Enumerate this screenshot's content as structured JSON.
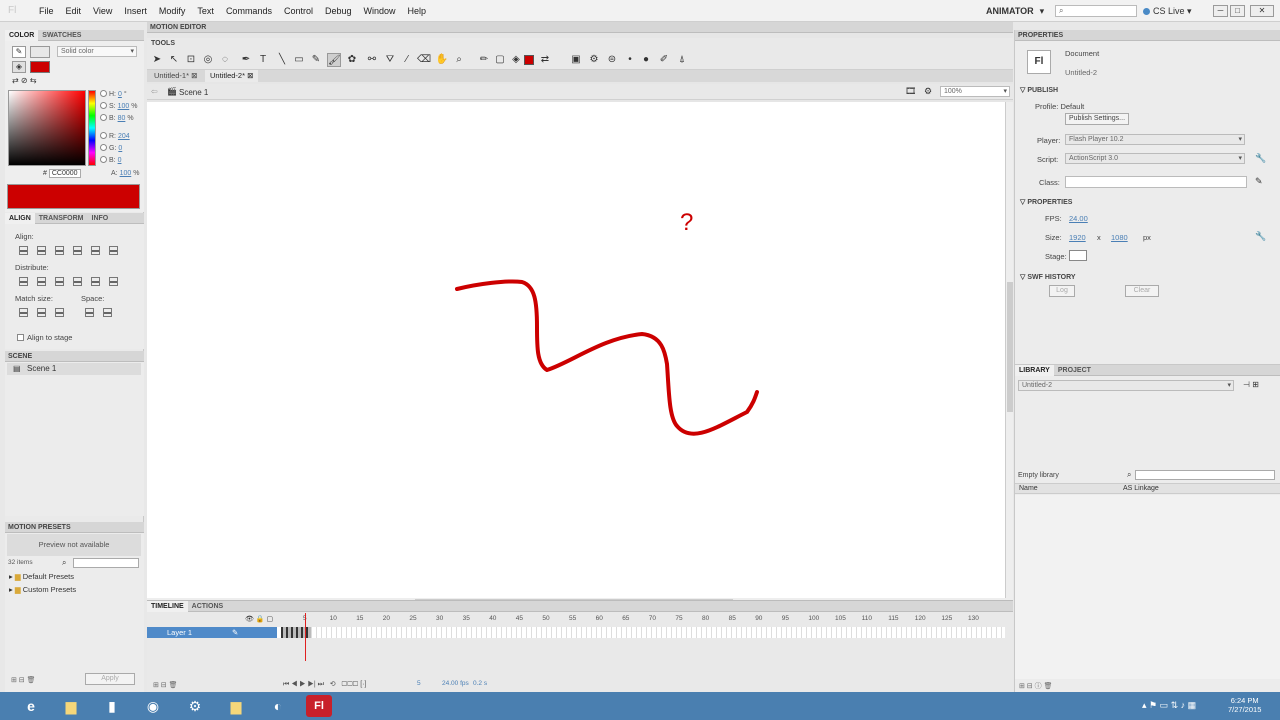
{
  "app": {
    "logo": "Fl",
    "menus": [
      "File",
      "Edit",
      "View",
      "Insert",
      "Modify",
      "Text",
      "Commands",
      "Control",
      "Debug",
      "Window",
      "Help"
    ],
    "workspace": "ANIMATOR",
    "search_placeholder": "",
    "cs_live": "CS Live"
  },
  "color_panel": {
    "tabs": [
      "COLOR",
      "SWATCHES"
    ],
    "fill_type": "Solid color",
    "h_label": "H:",
    "h_value": "0",
    "h_unit": "°",
    "s_label": "S:",
    "s_value": "100",
    "s_unit": "%",
    "b_label": "B:",
    "b_value": "80",
    "b_unit": "%",
    "r_label": "R:",
    "r_value": "204",
    "g_label": "G:",
    "g_value": "0",
    "bb_label": "B:",
    "bb_value": "0",
    "hex_label": "#",
    "hex_value": "CC0000",
    "alpha_label": "A:",
    "alpha_value": "100",
    "alpha_unit": "%",
    "current_color": "#cc0000"
  },
  "align_panel": {
    "tabs": [
      "ALIGN",
      "TRANSFORM",
      "INFO"
    ],
    "align_label": "Align:",
    "distribute_label": "Distribute:",
    "match_size_label": "Match size:",
    "space_label": "Space:",
    "align_to_stage": "Align to stage"
  },
  "scene_panel": {
    "title": "SCENE",
    "items": [
      "Scene 1"
    ]
  },
  "motion_presets": {
    "title": "MOTION PRESETS",
    "preview": "Preview not available",
    "count": "32 items",
    "folders": [
      "Default Presets",
      "Custom Presets"
    ],
    "apply": "Apply"
  },
  "main": {
    "motion_editor_tab": "MOTION EDITOR",
    "tools_label": "TOOLS",
    "doc_tabs": [
      "Untitled-1*",
      "Untitled-2*"
    ],
    "scene_crumb": "Scene 1",
    "zoom": "100%",
    "stroke_color": "#cc0000"
  },
  "canvas_drawing": {
    "annotation": "?"
  },
  "timeline": {
    "tabs": [
      "TIMELINE",
      "ACTIONS"
    ],
    "layer_name": "Layer 1",
    "frame_numbers": [
      "5",
      "10",
      "15",
      "20",
      "25",
      "30",
      "35",
      "40",
      "45",
      "50",
      "55",
      "60",
      "65",
      "70",
      "75",
      "80",
      "85",
      "90",
      "95",
      "100",
      "105",
      "110",
      "115",
      "120",
      "125",
      "130"
    ],
    "current_frame": "5",
    "fps_readout": "24.00 fps",
    "time_readout": "0.2 s"
  },
  "properties": {
    "title": "PROPERTIES",
    "doc_type": "Document",
    "doc_name": "Untitled-2",
    "publish_section": "PUBLISH",
    "profile_label": "Profile:",
    "profile_value": "Default",
    "publish_settings": "Publish Settings...",
    "player_label": "Player:",
    "player_value": "Flash Player 10.2",
    "script_label": "Script:",
    "script_value": "ActionScript 3.0",
    "class_label": "Class:",
    "properties_section": "PROPERTIES",
    "fps_label": "FPS:",
    "fps_value": "24.00",
    "size_label": "Size:",
    "width": "1920",
    "x": "x",
    "height": "1080",
    "unit": "px",
    "stage_label": "Stage:",
    "swf_section": "SWF HISTORY",
    "log_btn": "Log",
    "clear_btn": "Clear"
  },
  "library": {
    "tabs": [
      "LIBRARY",
      "PROJECT"
    ],
    "doc": "Untitled-2",
    "status": "Empty library",
    "col_name": "Name",
    "col_linkage": "AS Linkage"
  },
  "taskbar": {
    "time": "6:24 PM",
    "date": "7/27/2015"
  }
}
